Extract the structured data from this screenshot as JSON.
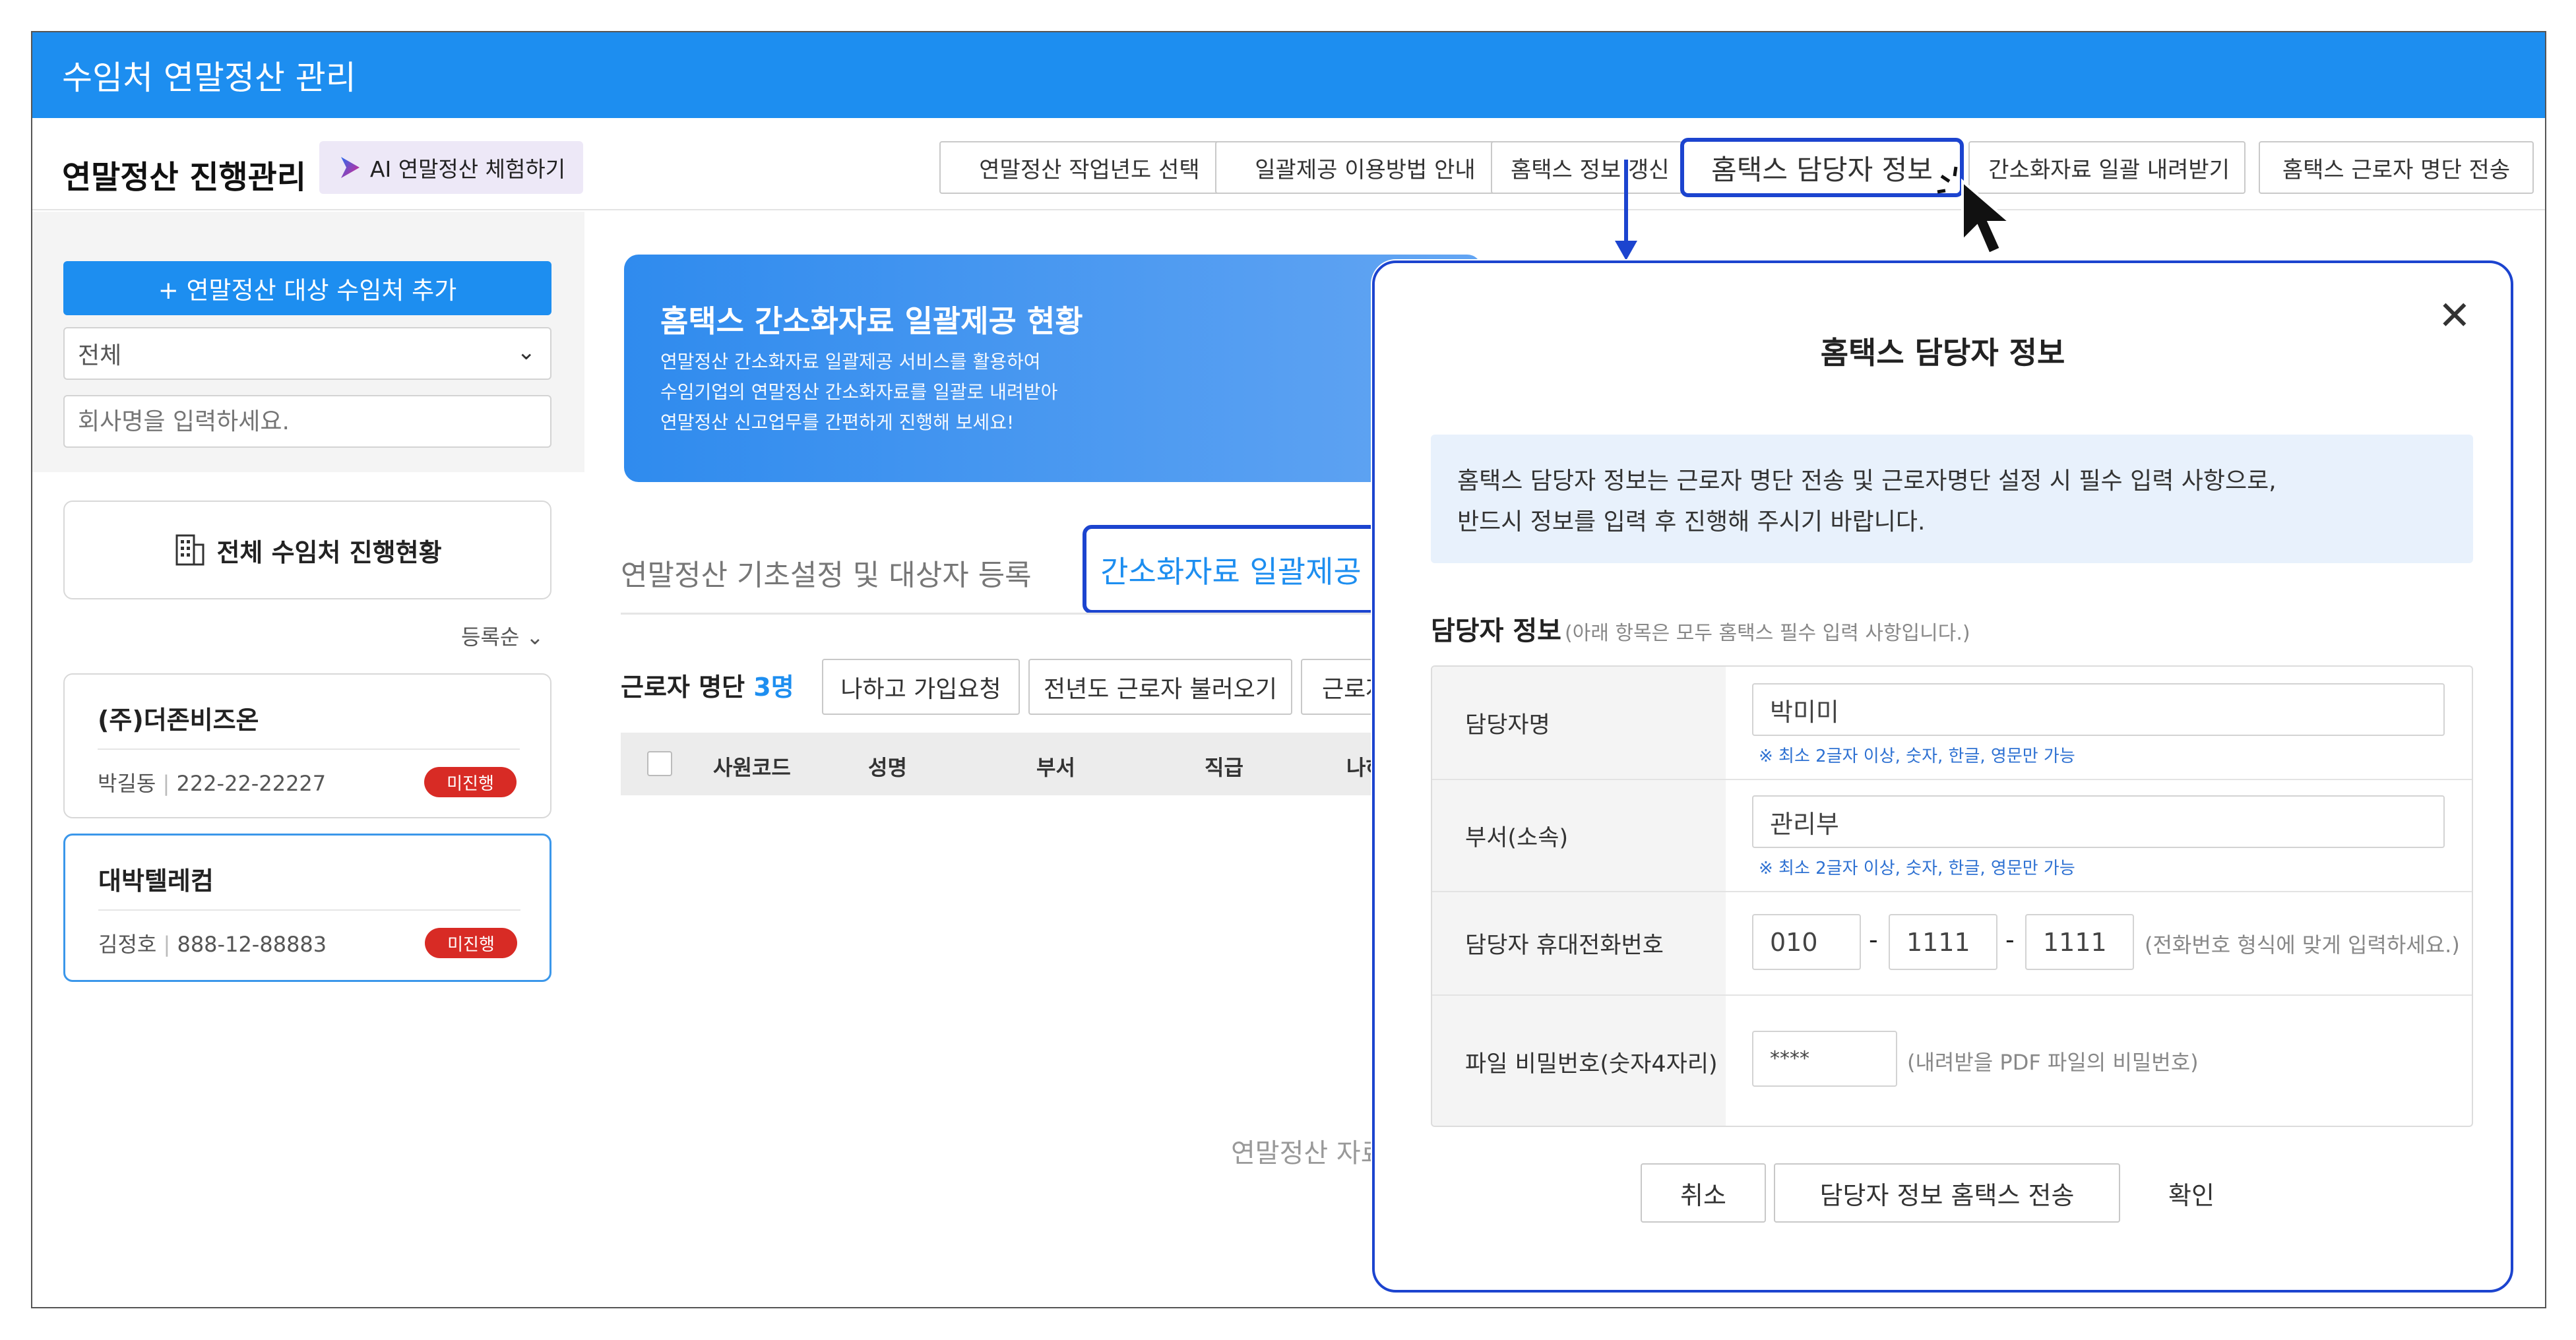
{
  "window": {
    "title": "수임처 연말정산 관리"
  },
  "toolbar": {
    "brand": "연말정산 진행관리",
    "ai_button": "AI 연말정산 체험하기",
    "buttons": [
      "연말정산 작업년도 선택",
      "일괄제공 이용방법 안내",
      "홈택스 정보 갱신",
      "홈택스 담당자 정보",
      "간소화자료 일괄 내려받기",
      "홈택스 근로자 명단 전송"
    ]
  },
  "sidebar": {
    "add_button": "+ 연말정산 대상 수임처 추가",
    "filter_value": "전체",
    "search_placeholder": "회사명을 입력하세요.",
    "status_button": "전체 수임처 진행현황",
    "sort_label": "등록순",
    "clients": [
      {
        "name": "(주)더존비즈온",
        "rep": "박길동",
        "biz_no": "222-22-22227",
        "status": "미진행"
      },
      {
        "name": "대박텔레컴",
        "rep": "김정호",
        "biz_no": "888-12-88883",
        "status": "미진행"
      }
    ]
  },
  "main": {
    "banner": {
      "title": "홈택스 간소화자료 일괄제공 현황",
      "lines": [
        "연말정산 간소화자료 일괄제공 서비스를 활용하여",
        "수임기업의 연말정산 간소화자료를 일괄로 내려받아",
        "연말정산 신고업무를 간편하게 진행해 보세요!"
      ]
    },
    "tabs": [
      "연말정산 기초설정 및 대상자 등록",
      "간소화자료 일괄제공"
    ],
    "list_label": "근로자 명단",
    "list_count": "3명",
    "buttons": [
      "나하고 가입요청",
      "전년도 근로자 불러오기",
      "근로자명"
    ],
    "columns": [
      "사원코드",
      "성명",
      "부서",
      "직급",
      "나하"
    ],
    "empty_text": "연말정산 자료입"
  },
  "modal": {
    "title": "홈택스 담당자 정보",
    "info_lines": [
      "홈택스 담당자 정보는 근로자 명단 전송 및 근로자명단 설정 시 필수 입력 사항으로,",
      "반드시 정보를 입력 후 진행해 주시기 바랍니다."
    ],
    "section_title": "담당자 정보",
    "section_note": "(아래 항목은 모두 홈택스 필수 입력 사항입니다.)",
    "fields": {
      "name_label": "담당자명",
      "name_value": "박미미",
      "name_hint": "※ 최소 2글자 이상, 숫자, 한글, 영문만 가능",
      "dept_label": "부서(소속)",
      "dept_value": "관리부",
      "dept_hint": "※ 최소 2글자 이상, 숫자, 한글, 영문만 가능",
      "phone_label": "담당자 휴대전화번호",
      "phone_1": "010",
      "phone_2": "1111",
      "phone_3": "1111",
      "phone_sep": "-",
      "phone_note": "(전화번호 형식에 맞게 입력하세요.)",
      "pw_label": "파일 비밀번호(숫자4자리)",
      "pw_value": "****",
      "pw_note": "(내려받을 PDF 파일의 비밀번호)"
    },
    "buttons": {
      "cancel": "취소",
      "send": "담당자 정보 홈택스 전송",
      "confirm": "확인"
    }
  },
  "colors": {
    "primary": "#1d8ef0",
    "highlight": "#1c44cf",
    "badge": "#d82b25"
  },
  "icons": [
    "ai-logo-icon",
    "chevron-down-icon",
    "building-icon",
    "close-icon",
    "mouse-cursor-icon",
    "arrow-icon"
  ]
}
